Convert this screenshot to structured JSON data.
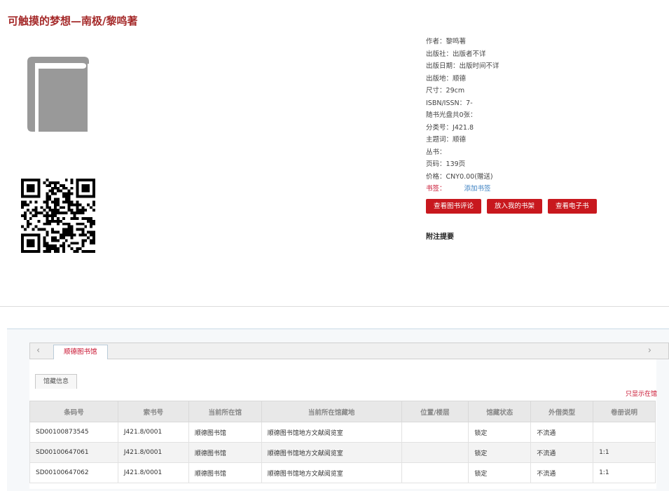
{
  "book": {
    "title": "可触摸的梦想—南极/黎鸣著"
  },
  "icons": {
    "cover": "book-icon",
    "qr": "qr-code-icon",
    "left_arrow": "chevron-left-icon",
    "right_arrow": "chevron-right-icon"
  },
  "meta": [
    {
      "key": "作者",
      "value": "黎鸣著"
    },
    {
      "key": "出版社",
      "value": "出版者不详"
    },
    {
      "key": "出版日期",
      "value": "出版时间不详"
    },
    {
      "key": "出版地",
      "value": "顺德"
    },
    {
      "key": "尺寸",
      "value": "29cm"
    },
    {
      "key": "ISBN/ISSN",
      "value": "7-"
    },
    {
      "key": "随书光盘共0张",
      "value": ""
    },
    {
      "key": "分类号",
      "value": "J421.8"
    },
    {
      "key": "主题词",
      "value": "顺德"
    },
    {
      "key": "丛书",
      "value": ""
    },
    {
      "key": "页码",
      "value": "139页"
    },
    {
      "key": "价格",
      "value": "CNY0.00(赠送)"
    }
  ],
  "tags": {
    "label": "书签：",
    "add_label": "添加书签"
  },
  "buttons": {
    "review": "查看图书评论",
    "shelf": "放入我的书架",
    "ebook": "查看电子书"
  },
  "note_title": "附注提要",
  "holdings": {
    "library_tab": "顺德图书馆",
    "sub_tab": "馆藏信息",
    "only_show": "只显示在馆",
    "columns": [
      "条码号",
      "索书号",
      "当前所在馆",
      "当前所在馆藏地",
      "位置/楼层",
      "馆藏状态",
      "外借类型",
      "卷册说明"
    ],
    "rows": [
      [
        "SD00100873545",
        "J421.8/0001",
        "顺德图书馆",
        "顺德图书馆地方文献阅览室",
        "",
        "锁定",
        "不流通",
        ""
      ],
      [
        "SD00100647061",
        "J421.8/0001",
        "顺德图书馆",
        "顺德图书馆地方文献阅览室",
        "",
        "锁定",
        "不流通",
        "1:1"
      ],
      [
        "SD00100647062",
        "J421.8/0001",
        "顺德图书馆",
        "顺德图书馆地方文献阅览室",
        "",
        "锁定",
        "不流通",
        "1:1"
      ]
    ]
  },
  "colors": {
    "accent_red": "#c8181e",
    "title_red": "#a52a2a",
    "link_blue": "#3a7fc1"
  }
}
